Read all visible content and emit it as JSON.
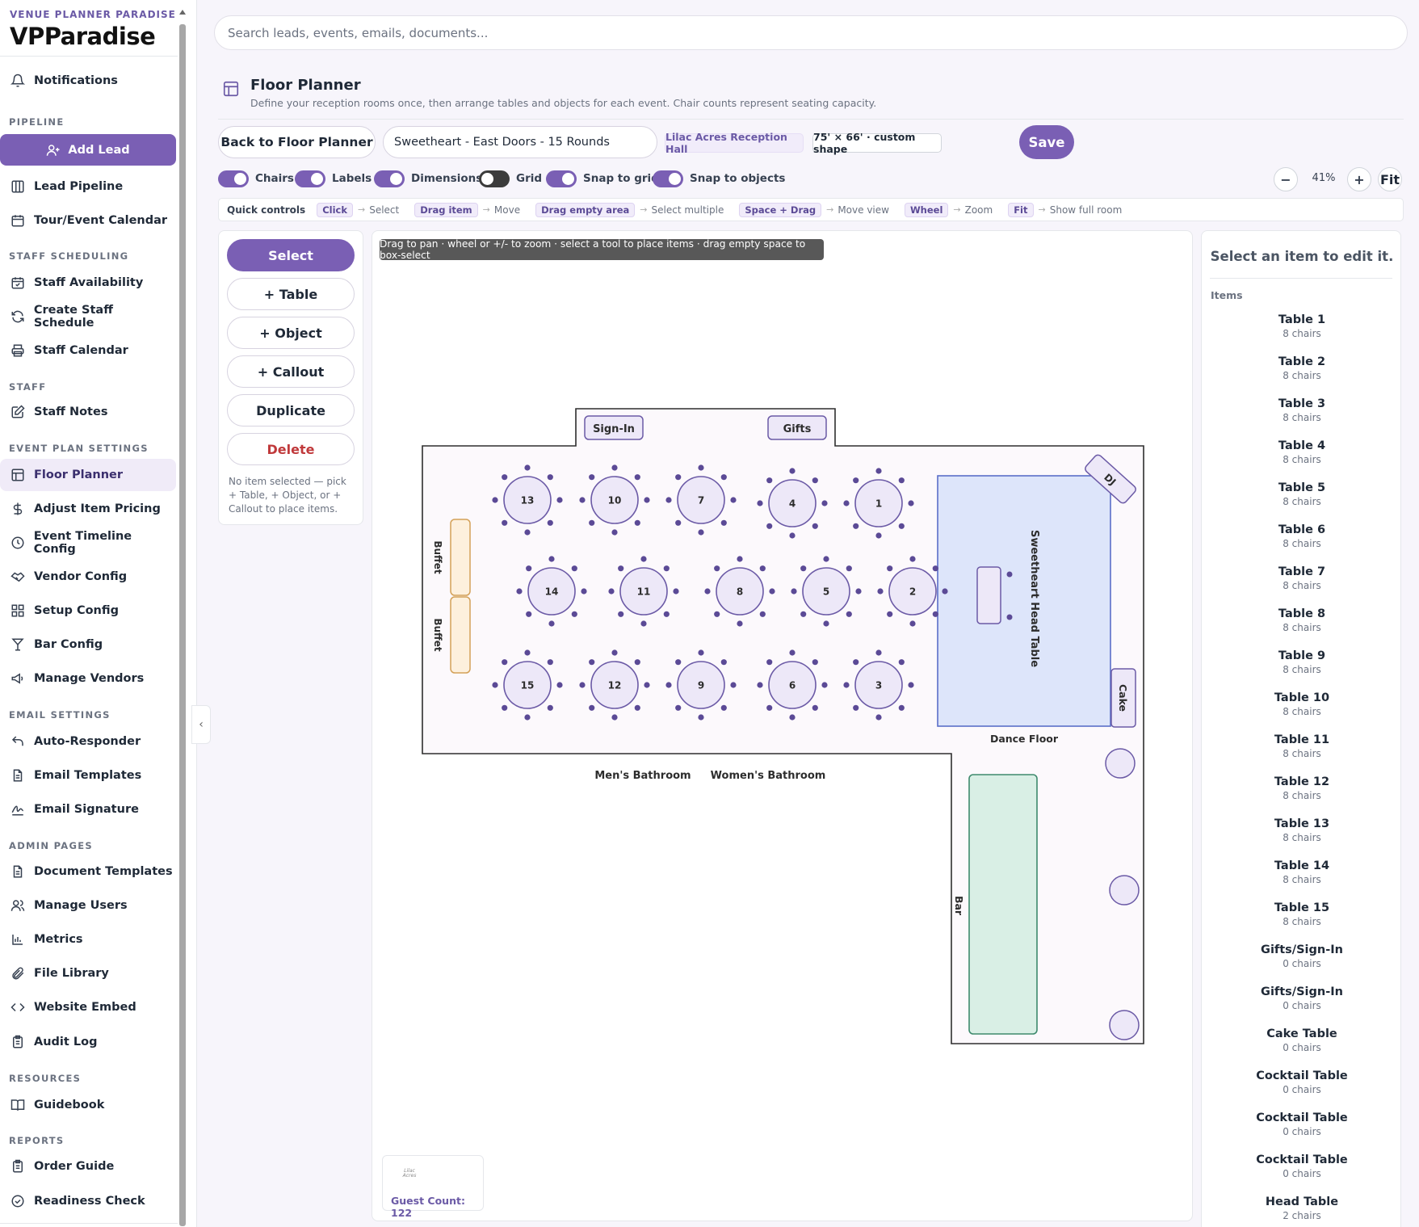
{
  "brand": {
    "subtitle": "VENUE PLANNER PARADISE",
    "name": "VPParadise"
  },
  "sidebar": {
    "notifications": "Notifications",
    "pipeline_header": "PIPELINE",
    "add_lead": "Add Lead",
    "lead_pipeline": "Lead Pipeline",
    "tour_calendar": "Tour/Event Calendar",
    "staff_scheduling_header": "STAFF SCHEDULING",
    "staff_availability": "Staff Availability",
    "create_staff_schedule": "Create Staff Schedule",
    "staff_calendar": "Staff Calendar",
    "staff_header": "STAFF",
    "staff_notes": "Staff Notes",
    "event_plan_header": "EVENT PLAN SETTINGS",
    "floor_planner": "Floor Planner",
    "adjust_item_pricing": "Adjust Item Pricing",
    "event_timeline_config": "Event Timeline Config",
    "vendor_config": "Vendor Config",
    "setup_config": "Setup Config",
    "bar_config": "Bar Config",
    "manage_vendors": "Manage Vendors",
    "email_header": "EMAIL SETTINGS",
    "auto_responder": "Auto-Responder",
    "email_templates": "Email Templates",
    "email_signature": "Email Signature",
    "admin_header": "ADMIN PAGES",
    "document_templates": "Document Templates",
    "manage_users": "Manage Users",
    "metrics": "Metrics",
    "file_library": "File Library",
    "website_embed": "Website Embed",
    "audit_log": "Audit Log",
    "resources_header": "RESOURCES",
    "guidebook": "Guidebook",
    "reports_header": "REPORTS",
    "order_guide": "Order Guide",
    "readiness_check": "Readiness Check"
  },
  "search": {
    "placeholder": "Search leads, events, emails, documents..."
  },
  "page": {
    "title": "Floor Planner",
    "description": "Define your reception rooms once, then arrange tables and objects for each event. Chair counts represent seating capacity."
  },
  "toolbar": {
    "back_label": "Back to Floor Planner",
    "layout_name": "Sweetheart - East Doors - 15 Rounds",
    "room_chip": "Lilac Acres Reception Hall",
    "size_chip": "75' × 66' · custom shape",
    "save_label": "Save"
  },
  "toggles": {
    "chairs": {
      "label": "Chairs",
      "on": true
    },
    "labels": {
      "label": "Labels",
      "on": true
    },
    "dimensions": {
      "label": "Dimensions",
      "on": true
    },
    "grid": {
      "label": "Grid",
      "on": false
    },
    "snap_grid": {
      "label": "Snap to grid",
      "on": true
    },
    "snap_objects": {
      "label": "Snap to objects",
      "on": true
    }
  },
  "zoom": {
    "minus": "−",
    "value": "41%",
    "plus": "+",
    "fit": "Fit"
  },
  "quick_controls": {
    "title": "Quick controls",
    "items": [
      {
        "key": "Click",
        "action": "Select"
      },
      {
        "key": "Drag item",
        "action": "Move"
      },
      {
        "key": "Drag empty area",
        "action": "Select multiple"
      },
      {
        "key": "Space + Drag",
        "action": "Move view"
      },
      {
        "key": "Wheel",
        "action": "Zoom"
      },
      {
        "key": "Fit",
        "action": "Show full room"
      }
    ],
    "arrow": "→"
  },
  "tools": {
    "select": "Select",
    "table": "+ Table",
    "object": "+ Object",
    "callout": "+ Callout",
    "duplicate": "Duplicate",
    "delete": "Delete",
    "hint": "No item selected — pick + Table, + Object, or + Callout to place items."
  },
  "canvas": {
    "tip": "Drag to pan · wheel or +/- to zoom · select a tool to place items · drag empty space to box-select",
    "labels": {
      "sign_in": "Sign-In",
      "gifts": "Gifts",
      "dj": "DJ",
      "buffet": "Buffet",
      "head_table": "Sweetheart Head Table",
      "cake": "Cake",
      "dance_floor": "Dance Floor",
      "mens_bathroom": "Men's Bathroom",
      "womens_bathroom": "Women's Bathroom",
      "bar": "Bar"
    },
    "tables": [
      "13",
      "10",
      "7",
      "4",
      "1",
      "14",
      "11",
      "8",
      "5",
      "2",
      "15",
      "12",
      "9",
      "6",
      "3"
    ],
    "chairs_per_table": 8,
    "guest_count": "Guest Count: 122",
    "logo_text": "Lilac Acres"
  },
  "right_panel": {
    "title": "Select an item to edit it.",
    "items_label": "Items",
    "items": [
      {
        "name": "Table 1",
        "chairs": "8 chairs"
      },
      {
        "name": "Table 2",
        "chairs": "8 chairs"
      },
      {
        "name": "Table 3",
        "chairs": "8 chairs"
      },
      {
        "name": "Table 4",
        "chairs": "8 chairs"
      },
      {
        "name": "Table 5",
        "chairs": "8 chairs"
      },
      {
        "name": "Table 6",
        "chairs": "8 chairs"
      },
      {
        "name": "Table 7",
        "chairs": "8 chairs"
      },
      {
        "name": "Table 8",
        "chairs": "8 chairs"
      },
      {
        "name": "Table 9",
        "chairs": "8 chairs"
      },
      {
        "name": "Table 10",
        "chairs": "8 chairs"
      },
      {
        "name": "Table 11",
        "chairs": "8 chairs"
      },
      {
        "name": "Table 12",
        "chairs": "8 chairs"
      },
      {
        "name": "Table 13",
        "chairs": "8 chairs"
      },
      {
        "name": "Table 14",
        "chairs": "8 chairs"
      },
      {
        "name": "Table 15",
        "chairs": "8 chairs"
      },
      {
        "name": "Gifts/Sign-In",
        "chairs": "0 chairs"
      },
      {
        "name": "Gifts/Sign-In",
        "chairs": "0 chairs"
      },
      {
        "name": "Cake Table",
        "chairs": "0 chairs"
      },
      {
        "name": "Cocktail Table",
        "chairs": "0 chairs"
      },
      {
        "name": "Cocktail Table",
        "chairs": "0 chairs"
      },
      {
        "name": "Cocktail Table",
        "chairs": "0 chairs"
      },
      {
        "name": "Head Table",
        "chairs": "2 chairs"
      }
    ]
  },
  "colors": {
    "accent": "#7a5fb4",
    "table_fill": "#ede8f8",
    "table_stroke": "#6b5aa6",
    "dance_floor": "#dde5fa",
    "bar_fill": "#d9efe5",
    "buffet_fill": "#fdf0dd"
  }
}
